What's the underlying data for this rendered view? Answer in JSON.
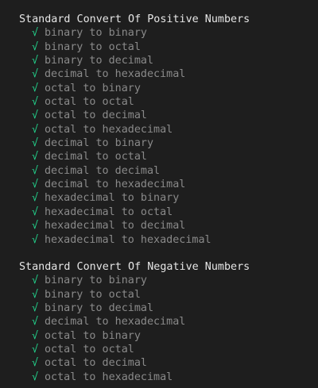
{
  "suites": [
    {
      "title": "Standard Convert Of Positive Numbers",
      "tests": [
        {
          "mark": "√",
          "name": "binary to binary"
        },
        {
          "mark": "√",
          "name": "binary to octal"
        },
        {
          "mark": "√",
          "name": "binary to decimal"
        },
        {
          "mark": "√",
          "name": "decimal to hexadecimal"
        },
        {
          "mark": "√",
          "name": "octal to binary"
        },
        {
          "mark": "√",
          "name": "octal to octal"
        },
        {
          "mark": "√",
          "name": "octal to decimal"
        },
        {
          "mark": "√",
          "name": "octal to hexadecimal"
        },
        {
          "mark": "√",
          "name": "decimal to binary"
        },
        {
          "mark": "√",
          "name": "decimal to octal"
        },
        {
          "mark": "√",
          "name": "decimal to decimal"
        },
        {
          "mark": "√",
          "name": "decimal to hexadecimal"
        },
        {
          "mark": "√",
          "name": "hexadecimal to binary"
        },
        {
          "mark": "√",
          "name": "hexadecimal to octal"
        },
        {
          "mark": "√",
          "name": "hexadecimal to decimal"
        },
        {
          "mark": "√",
          "name": "hexadecimal to hexadecimal"
        }
      ]
    },
    {
      "title": "Standard Convert Of Negative Numbers",
      "tests": [
        {
          "mark": "√",
          "name": "binary to binary"
        },
        {
          "mark": "√",
          "name": "binary to octal"
        },
        {
          "mark": "√",
          "name": "binary to decimal"
        },
        {
          "mark": "√",
          "name": "decimal to hexadecimal"
        },
        {
          "mark": "√",
          "name": "octal to binary"
        },
        {
          "mark": "√",
          "name": "octal to octal"
        },
        {
          "mark": "√",
          "name": "octal to decimal"
        },
        {
          "mark": "√",
          "name": "octal to hexadecimal"
        }
      ]
    }
  ],
  "colors": {
    "background": "#1e1e1e",
    "pass_mark": "#23d18b",
    "test_name": "#8a8a8a",
    "suite_title": "#e6e6e6"
  }
}
